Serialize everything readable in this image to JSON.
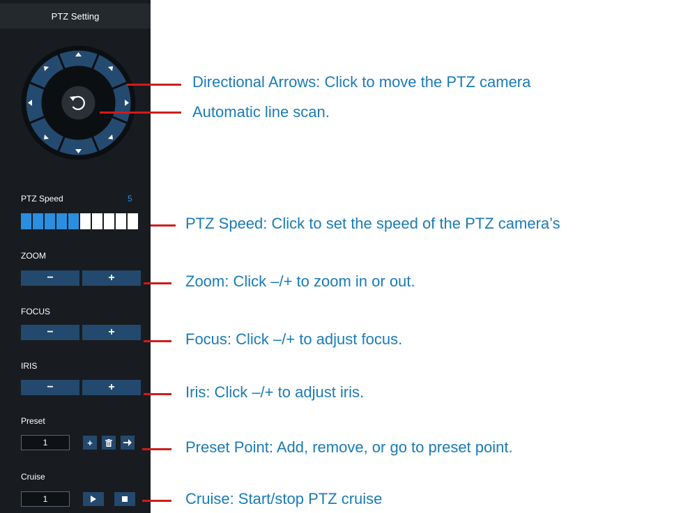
{
  "panel": {
    "title": "PTZ Setting",
    "dial_icons": {
      "center": "rotate-icon",
      "arrows": [
        "arrow-up-icon",
        "arrow-up-right-icon",
        "arrow-right-icon",
        "arrow-down-right-icon",
        "arrow-down-icon",
        "arrow-down-left-icon",
        "arrow-left-icon",
        "arrow-up-left-icon"
      ]
    },
    "speed": {
      "label": "PTZ Speed",
      "value": "5",
      "active_level": 5,
      "max_level": 10
    },
    "zoom": {
      "label": "ZOOM",
      "minus": "−",
      "plus": "+"
    },
    "focus": {
      "label": "FOCUS",
      "minus": "−",
      "plus": "+"
    },
    "iris": {
      "label": "IRIS",
      "minus": "−",
      "plus": "+"
    },
    "preset": {
      "label": "Preset",
      "value": "1",
      "icons": [
        "plus-icon",
        "trash-icon",
        "arrow-right-icon"
      ]
    },
    "cruise": {
      "label": "Cruise",
      "value": "1",
      "icons": [
        "play-icon",
        "stop-icon"
      ]
    }
  },
  "annotations": {
    "directional": "Directional Arrows: Click to move the PTZ camera",
    "line_scan": "Automatic line scan.",
    "speed": "PTZ Speed: Click to set the speed of the PTZ camera’s",
    "zoom": "Zoom: Click –/+ to zoom in or out.",
    "focus": "Focus: Click –/+ to adjust focus.",
    "iris": "Iris: Click –/+ to adjust iris.",
    "preset": "Preset Point: Add, remove, or go to preset point.",
    "cruise": "Cruise: Start/stop PTZ cruise"
  },
  "colors": {
    "panel_bg": "#181c20",
    "button_bg": "#24496e",
    "accent_blue": "#2a8fe0",
    "callout_red": "#d11b1b",
    "callout_text": "#1a7bb8"
  }
}
